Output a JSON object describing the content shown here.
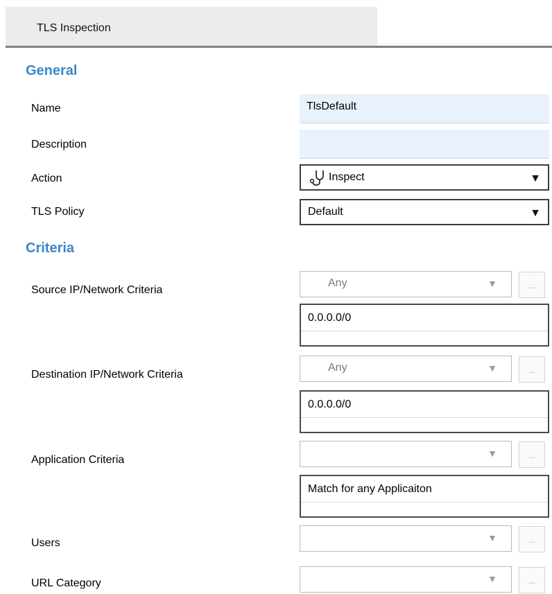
{
  "tab": {
    "label": "TLS Inspection"
  },
  "sections": {
    "general": "General",
    "criteria": "Criteria"
  },
  "general": {
    "name": {
      "label": "Name",
      "value": "TlsDefault"
    },
    "description": {
      "label": "Description",
      "value": ""
    },
    "action": {
      "label": "Action",
      "value": "Inspect",
      "icon": "stethoscope-icon"
    },
    "tls_policy": {
      "label": "TLS Policy",
      "value": "Default"
    }
  },
  "criteria": {
    "source": {
      "label": "Source IP/Network Criteria",
      "combo_value": "Any",
      "list_value": "0.0.0.0/0",
      "button": "..."
    },
    "destination": {
      "label": "Destination IP/Network Criteria",
      "combo_value": "Any",
      "list_value": "0.0.0.0/0",
      "button": "..."
    },
    "application": {
      "label": "Application Criteria",
      "combo_value": "",
      "list_value": "Match for any Applicaiton",
      "button": "..."
    },
    "users": {
      "label": "Users",
      "combo_value": "",
      "button": "..."
    },
    "url_category": {
      "label": "URL Category",
      "combo_value": "",
      "button": "..."
    }
  },
  "colors": {
    "section_heading": "#3a86c8",
    "text_field_bg": "#e9f2fc",
    "tab_bg": "#ececec"
  }
}
